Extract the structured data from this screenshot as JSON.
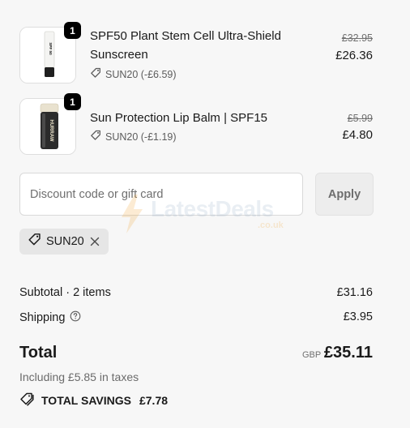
{
  "items": [
    {
      "name": "SPF50 Plant Stem Cell Ultra-Shield Sunscreen",
      "quantity": "1",
      "discount": "SUN20 (-£6.59)",
      "original_price": "£32.95",
      "price": "£26.36",
      "image": "sunscreen-tube",
      "product_label": "SPF 50"
    },
    {
      "name": "Sun Protection Lip Balm | SPF15",
      "quantity": "1",
      "discount": "SUN20 (-£1.19)",
      "original_price": "£5.99",
      "price": "£4.80",
      "image": "lip-balm-tube",
      "product_label": "HURRAW"
    }
  ],
  "discount": {
    "placeholder": "Discount code or gift card",
    "apply_label": "Apply",
    "applied_code": "SUN20"
  },
  "summary": {
    "subtotal_label": "Subtotal · 2 items",
    "subtotal_value": "£31.16",
    "shipping_label": "Shipping",
    "shipping_value": "£3.95",
    "total_label": "Total",
    "total_currency": "GBP",
    "total_value": "£35.11",
    "taxes_note": "Including £5.85 in taxes",
    "savings_label": "TOTAL SAVINGS",
    "savings_value": "£7.78"
  },
  "watermark": {
    "text": "LatestDeals",
    "subtext": ".co.uk"
  },
  "colors": {
    "background": "#f7f7f7",
    "text": "#1a1a1a",
    "muted": "#6b6b6b",
    "badge": "#000000"
  }
}
